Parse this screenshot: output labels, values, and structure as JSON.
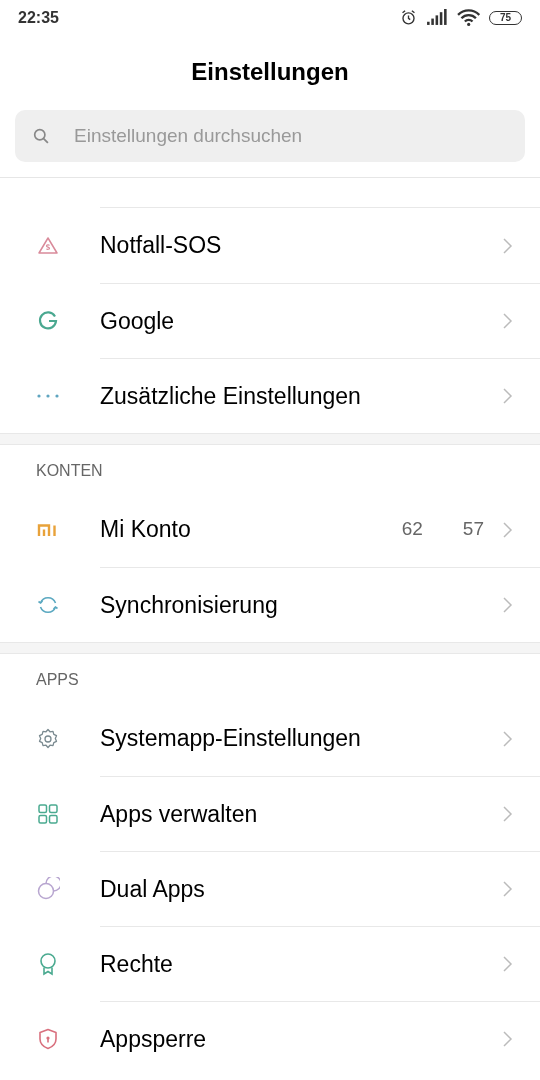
{
  "status_bar": {
    "time": "22:35",
    "battery": "75"
  },
  "title": "Einstellungen",
  "search": {
    "placeholder": "Einstellungen durchsuchen"
  },
  "sections": [
    {
      "items": [
        {
          "label": "Notfall-SOS"
        },
        {
          "label": "Google"
        },
        {
          "label": "Zusätzliche Einstellungen"
        }
      ]
    },
    {
      "header": "KONTEN",
      "items": [
        {
          "label": "Mi Konto",
          "values": [
            "62",
            "57"
          ]
        },
        {
          "label": "Synchronisierung"
        }
      ]
    },
    {
      "header": "APPS",
      "items": [
        {
          "label": "Systemapp-Einstellungen"
        },
        {
          "label": "Apps verwalten"
        },
        {
          "label": "Dual Apps"
        },
        {
          "label": "Rechte"
        },
        {
          "label": "Appsperre"
        }
      ]
    }
  ]
}
